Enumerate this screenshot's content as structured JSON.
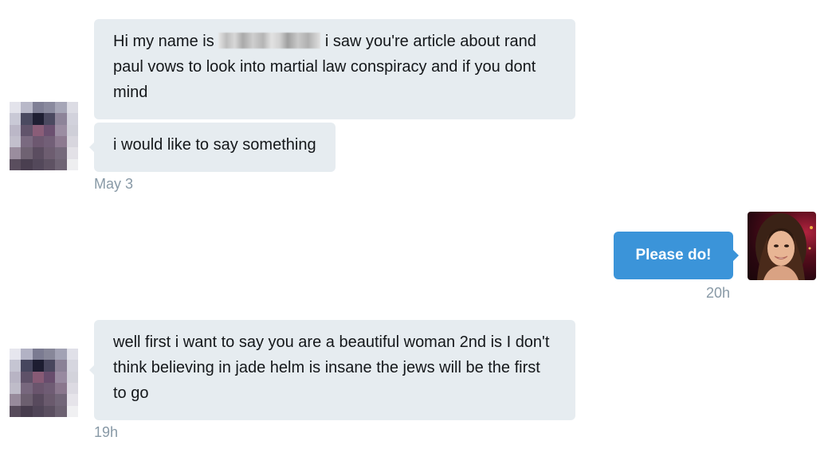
{
  "thread": {
    "messages": [
      {
        "direction": "incoming",
        "parts": [
          {
            "text_before": "Hi my name is",
            "text_after": "i saw you're article about rand paul vows to look into martial law conspiracy and if you dont mind"
          },
          {
            "text": "i would like to say something"
          }
        ],
        "timestamp": "May 3"
      },
      {
        "direction": "outgoing",
        "text": "Please do!",
        "timestamp": "20h"
      },
      {
        "direction": "incoming",
        "text": "well first i want to say you are a beautiful woman 2nd is I don't think believing in jade helm is insane the jews will be the first to go",
        "timestamp": "19h"
      }
    ]
  },
  "colors": {
    "incoming_bubble": "#e6ecf0",
    "outgoing_bubble": "#3b94d9",
    "timestamp": "#8899a6"
  },
  "icons": {
    "sender_avatar": "pixelated-avatar-icon",
    "own_avatar": "profile-photo-icon",
    "redaction": "blurred-name-icon"
  }
}
